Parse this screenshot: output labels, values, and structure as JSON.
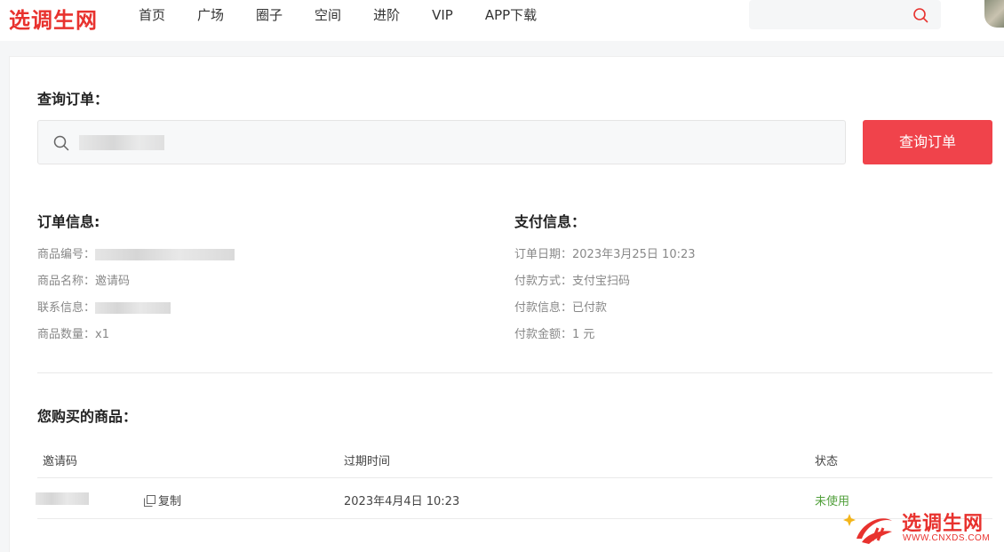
{
  "header": {
    "logo": "选调生网",
    "nav": [
      "首页",
      "广场",
      "圈子",
      "空间",
      "进阶",
      "VIP",
      "APP下载"
    ],
    "search_placeholder": ""
  },
  "query": {
    "title": "查询订单：",
    "button": "查询订单",
    "input_placeholder": ""
  },
  "order_info": {
    "title": "订单信息:",
    "product_no_label": "商品编号：",
    "product_name_label": "商品名称：",
    "product_name": "邀请码",
    "contact_label": "联系信息：",
    "quantity_label": "商品数量：",
    "quantity": "x1"
  },
  "payment_info": {
    "title": "支付信息：",
    "date_label": "订单日期：",
    "date": "2023年3月25日 10:23",
    "method_label": "付款方式：",
    "method": "支付宝扫码",
    "status_label": "付款信息：",
    "status": "已付款",
    "amount_label": "付款金额：",
    "amount": "1 元"
  },
  "purchased": {
    "title": "您购买的商品：",
    "columns": [
      "邀请码",
      "过期时间",
      "状态"
    ],
    "rows": [
      {
        "copy": "复制",
        "expires": "2023年4月4日 10:23",
        "status": "未使用"
      }
    ]
  },
  "watermark": {
    "name": "选调生网",
    "url": "WWW.CNXDS.COM"
  },
  "colors": {
    "brand": "#e8322e",
    "button": "#f0434b",
    "status_unused": "#52a03c"
  },
  "icons": [
    "search-icon",
    "copy-icon"
  ]
}
